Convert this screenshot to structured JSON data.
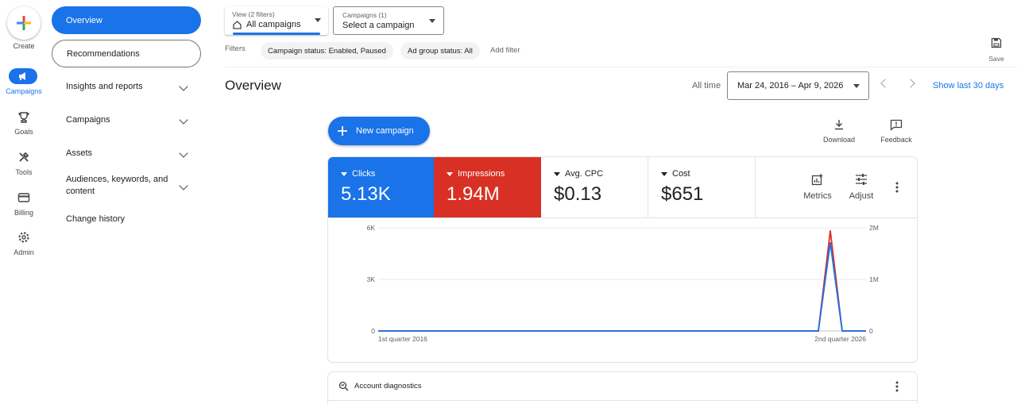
{
  "rail": {
    "create": "Create",
    "campaigns": "Campaigns",
    "goals": "Goals",
    "tools": "Tools",
    "billing": "Billing",
    "admin": "Admin"
  },
  "nav": {
    "overview": "Overview",
    "recommendations": "Recommendations",
    "insights": "Insights and reports",
    "campaigns": "Campaigns",
    "assets": "Assets",
    "audiences_line1": "Audiences, keywords, and",
    "audiences_line2": "content",
    "change_history": "Change history"
  },
  "topbar": {
    "view_small": "View (2 filters)",
    "view_main": "All campaigns",
    "campaigns_small": "Campaigns (1)",
    "campaigns_main": "Select a campaign",
    "filters_label": "Filters",
    "chip1": "Campaign status: Enabled, Paused",
    "chip2": "Ad group status: All",
    "add_filter": "Add filter",
    "save": "Save"
  },
  "header": {
    "title": "Overview",
    "all_time": "All time",
    "date_range": "Mar 24, 2016 – Apr 9, 2026",
    "show_last": "Show last 30 days"
  },
  "actions": {
    "new_campaign": "New campaign",
    "download": "Download",
    "feedback": "Feedback"
  },
  "metrics": {
    "clicks_label": "Clicks",
    "clicks_value": "5.13K",
    "impressions_label": "Impressions",
    "impressions_value": "1.94M",
    "cpc_label": "Avg. CPC",
    "cpc_value": "$0.13",
    "cost_label": "Cost",
    "cost_value": "$651",
    "metrics_btn": "Metrics",
    "adjust_btn": "Adjust"
  },
  "colors": {
    "clicks": "#1a73e8",
    "impressions": "#d93025"
  },
  "chart_data": {
    "type": "line",
    "x_labels": [
      "1st quarter 2016",
      "2nd quarter 2026"
    ],
    "y_left_ticks": [
      "0",
      "3K",
      "6K"
    ],
    "y_right_ticks": [
      "0",
      "1M",
      "2M"
    ],
    "ylim_left": [
      0,
      6000
    ],
    "ylim_right": [
      0,
      2000000
    ],
    "series": [
      {
        "name": "Clicks",
        "axis": "left",
        "color": "#1a73e8",
        "values": [
          0,
          0,
          0,
          0,
          5130,
          0
        ]
      },
      {
        "name": "Impressions",
        "axis": "right",
        "color": "#d93025",
        "values": [
          0,
          0,
          0,
          0,
          1940000,
          0
        ]
      }
    ],
    "grid": true
  },
  "diagnostics": {
    "label": "Account diagnostics"
  }
}
